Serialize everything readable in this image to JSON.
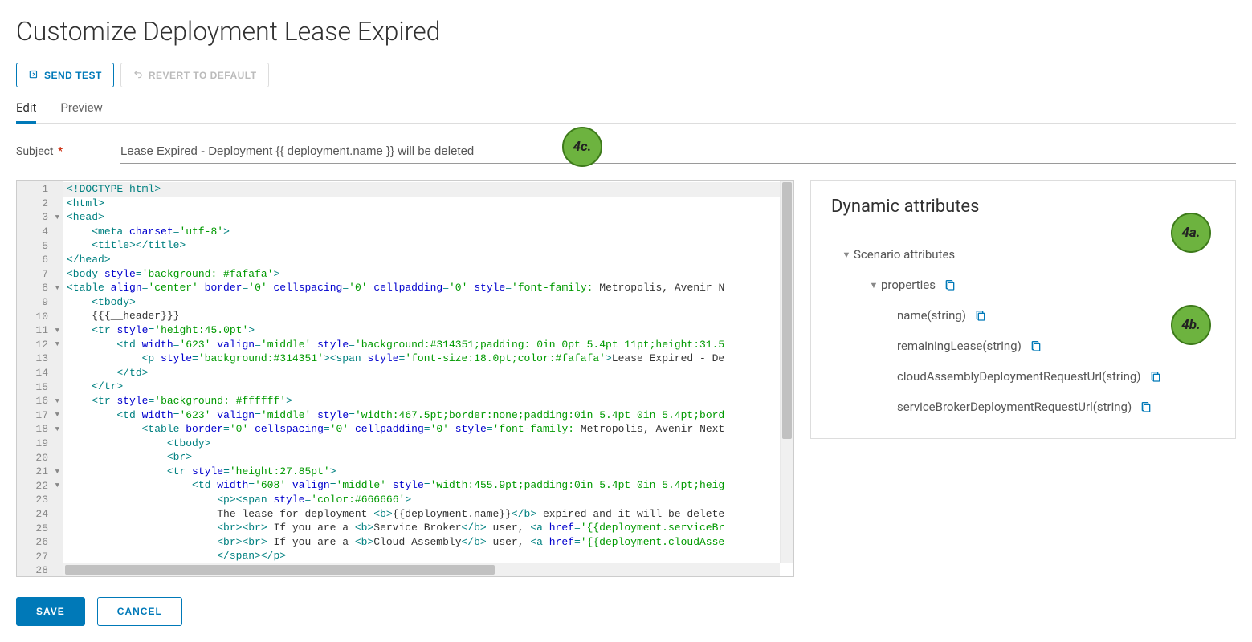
{
  "page": {
    "title": "Customize Deployment Lease Expired"
  },
  "toolbar": {
    "send_test": "SEND TEST",
    "revert": "REVERT TO DEFAULT"
  },
  "tabs": {
    "edit": "Edit",
    "preview": "Preview"
  },
  "subject": {
    "label": "Subject",
    "value": "Lease Expired - Deployment {{ deployment.name }} will be deleted"
  },
  "editor": {
    "lines": [
      {
        "n": 1,
        "active": true,
        "tokens": [
          {
            "c": "t-tag",
            "t": "<!DOCTYPE html>"
          }
        ]
      },
      {
        "n": 2,
        "tokens": [
          {
            "c": "t-tag",
            "t": "<html>"
          }
        ]
      },
      {
        "n": 3,
        "fold": true,
        "tokens": [
          {
            "c": "t-tag",
            "t": "<head>"
          }
        ]
      },
      {
        "n": 4,
        "tokens": [
          {
            "c": "",
            "t": "    "
          },
          {
            "c": "t-tag",
            "t": "<meta "
          },
          {
            "c": "t-attr",
            "t": "charset"
          },
          {
            "c": "t-tag",
            "t": "="
          },
          {
            "c": "t-val",
            "t": "'utf-8'"
          },
          {
            "c": "t-tag",
            "t": ">"
          }
        ]
      },
      {
        "n": 5,
        "tokens": [
          {
            "c": "",
            "t": "    "
          },
          {
            "c": "t-tag",
            "t": "<title></title>"
          }
        ]
      },
      {
        "n": 6,
        "tokens": [
          {
            "c": "t-tag",
            "t": "</head>"
          }
        ]
      },
      {
        "n": 7,
        "tokens": [
          {
            "c": "t-tag",
            "t": "<body "
          },
          {
            "c": "t-attr",
            "t": "style"
          },
          {
            "c": "t-tag",
            "t": "="
          },
          {
            "c": "t-val",
            "t": "'background: #fafafa'"
          },
          {
            "c": "t-tag",
            "t": ">"
          }
        ]
      },
      {
        "n": 8,
        "fold": true,
        "tokens": [
          {
            "c": "t-tag",
            "t": "<table "
          },
          {
            "c": "t-attr",
            "t": "align"
          },
          {
            "c": "t-tag",
            "t": "="
          },
          {
            "c": "t-val",
            "t": "'center' "
          },
          {
            "c": "t-attr",
            "t": "border"
          },
          {
            "c": "t-tag",
            "t": "="
          },
          {
            "c": "t-val",
            "t": "'0' "
          },
          {
            "c": "t-attr",
            "t": "cellspacing"
          },
          {
            "c": "t-tag",
            "t": "="
          },
          {
            "c": "t-val",
            "t": "'0' "
          },
          {
            "c": "t-attr",
            "t": "cellpadding"
          },
          {
            "c": "t-tag",
            "t": "="
          },
          {
            "c": "t-val",
            "t": "'0' "
          },
          {
            "c": "t-attr",
            "t": "style"
          },
          {
            "c": "t-tag",
            "t": "="
          },
          {
            "c": "t-val",
            "t": "'font-family: "
          },
          {
            "c": "t-txt",
            "t": "Metropolis, Avenir N"
          }
        ]
      },
      {
        "n": 9,
        "tokens": [
          {
            "c": "",
            "t": "    "
          },
          {
            "c": "t-tag",
            "t": "<tbody>"
          }
        ]
      },
      {
        "n": 10,
        "tokens": [
          {
            "c": "",
            "t": "    "
          },
          {
            "c": "t-txt",
            "t": "{{{__header}}}"
          }
        ]
      },
      {
        "n": 11,
        "fold": true,
        "tokens": [
          {
            "c": "",
            "t": "    "
          },
          {
            "c": "t-tag",
            "t": "<tr "
          },
          {
            "c": "t-attr",
            "t": "style"
          },
          {
            "c": "t-tag",
            "t": "="
          },
          {
            "c": "t-val",
            "t": "'height:45.0pt'"
          },
          {
            "c": "t-tag",
            "t": ">"
          }
        ]
      },
      {
        "n": 12,
        "fold": true,
        "tokens": [
          {
            "c": "",
            "t": "        "
          },
          {
            "c": "t-tag",
            "t": "<td "
          },
          {
            "c": "t-attr",
            "t": "width"
          },
          {
            "c": "t-tag",
            "t": "="
          },
          {
            "c": "t-val",
            "t": "'623' "
          },
          {
            "c": "t-attr",
            "t": "valign"
          },
          {
            "c": "t-tag",
            "t": "="
          },
          {
            "c": "t-val",
            "t": "'middle' "
          },
          {
            "c": "t-attr",
            "t": "style"
          },
          {
            "c": "t-tag",
            "t": "="
          },
          {
            "c": "t-val",
            "t": "'background:#314351;padding: 0in 0pt 5.4pt 11pt;height:31.5"
          }
        ]
      },
      {
        "n": 13,
        "tokens": [
          {
            "c": "",
            "t": "            "
          },
          {
            "c": "t-tag",
            "t": "<p "
          },
          {
            "c": "t-attr",
            "t": "style"
          },
          {
            "c": "t-tag",
            "t": "="
          },
          {
            "c": "t-val",
            "t": "'background:#314351'"
          },
          {
            "c": "t-tag",
            "t": "><span "
          },
          {
            "c": "t-attr",
            "t": "style"
          },
          {
            "c": "t-tag",
            "t": "="
          },
          {
            "c": "t-val",
            "t": "'font-size:18.0pt;color:#fafafa'"
          },
          {
            "c": "t-tag",
            "t": ">"
          },
          {
            "c": "t-txt",
            "t": "Lease Expired - De"
          }
        ]
      },
      {
        "n": 14,
        "tokens": [
          {
            "c": "",
            "t": "        "
          },
          {
            "c": "t-tag",
            "t": "</td>"
          }
        ]
      },
      {
        "n": 15,
        "tokens": [
          {
            "c": "",
            "t": "    "
          },
          {
            "c": "t-tag",
            "t": "</tr>"
          }
        ]
      },
      {
        "n": 16,
        "fold": true,
        "tokens": [
          {
            "c": "",
            "t": "    "
          },
          {
            "c": "t-tag",
            "t": "<tr "
          },
          {
            "c": "t-attr",
            "t": "style"
          },
          {
            "c": "t-tag",
            "t": "="
          },
          {
            "c": "t-val",
            "t": "'background: #ffffff'"
          },
          {
            "c": "t-tag",
            "t": ">"
          }
        ]
      },
      {
        "n": 17,
        "fold": true,
        "tokens": [
          {
            "c": "",
            "t": "        "
          },
          {
            "c": "t-tag",
            "t": "<td "
          },
          {
            "c": "t-attr",
            "t": "width"
          },
          {
            "c": "t-tag",
            "t": "="
          },
          {
            "c": "t-val",
            "t": "'623' "
          },
          {
            "c": "t-attr",
            "t": "valign"
          },
          {
            "c": "t-tag",
            "t": "="
          },
          {
            "c": "t-val",
            "t": "'middle' "
          },
          {
            "c": "t-attr",
            "t": "style"
          },
          {
            "c": "t-tag",
            "t": "="
          },
          {
            "c": "t-val",
            "t": "'width:467.5pt;border:none;padding:0in 5.4pt 0in 5.4pt;bord"
          }
        ]
      },
      {
        "n": 18,
        "fold": true,
        "tokens": [
          {
            "c": "",
            "t": "            "
          },
          {
            "c": "t-tag",
            "t": "<table "
          },
          {
            "c": "t-attr",
            "t": "border"
          },
          {
            "c": "t-tag",
            "t": "="
          },
          {
            "c": "t-val",
            "t": "'0' "
          },
          {
            "c": "t-attr",
            "t": "cellspacing"
          },
          {
            "c": "t-tag",
            "t": "="
          },
          {
            "c": "t-val",
            "t": "'0' "
          },
          {
            "c": "t-attr",
            "t": "cellpadding"
          },
          {
            "c": "t-tag",
            "t": "="
          },
          {
            "c": "t-val",
            "t": "'0' "
          },
          {
            "c": "t-attr",
            "t": "style"
          },
          {
            "c": "t-tag",
            "t": "="
          },
          {
            "c": "t-val",
            "t": "'font-family: "
          },
          {
            "c": "t-txt",
            "t": "Metropolis, Avenir Next"
          }
        ]
      },
      {
        "n": 19,
        "tokens": [
          {
            "c": "",
            "t": "                "
          },
          {
            "c": "t-tag",
            "t": "<tbody>"
          }
        ]
      },
      {
        "n": 20,
        "tokens": [
          {
            "c": "",
            "t": "                "
          },
          {
            "c": "t-tag",
            "t": "<br>"
          }
        ]
      },
      {
        "n": 21,
        "fold": true,
        "tokens": [
          {
            "c": "",
            "t": "                "
          },
          {
            "c": "t-tag",
            "t": "<tr "
          },
          {
            "c": "t-attr",
            "t": "style"
          },
          {
            "c": "t-tag",
            "t": "="
          },
          {
            "c": "t-val",
            "t": "'height:27.85pt'"
          },
          {
            "c": "t-tag",
            "t": ">"
          }
        ]
      },
      {
        "n": 22,
        "fold": true,
        "tokens": [
          {
            "c": "",
            "t": "                    "
          },
          {
            "c": "t-tag",
            "t": "<td "
          },
          {
            "c": "t-attr",
            "t": "width"
          },
          {
            "c": "t-tag",
            "t": "="
          },
          {
            "c": "t-val",
            "t": "'608' "
          },
          {
            "c": "t-attr",
            "t": "valign"
          },
          {
            "c": "t-tag",
            "t": "="
          },
          {
            "c": "t-val",
            "t": "'middle' "
          },
          {
            "c": "t-attr",
            "t": "style"
          },
          {
            "c": "t-tag",
            "t": "="
          },
          {
            "c": "t-val",
            "t": "'width:455.9pt;padding:0in 5.4pt 0in 5.4pt;heig"
          }
        ]
      },
      {
        "n": 23,
        "tokens": [
          {
            "c": "",
            "t": "                        "
          },
          {
            "c": "t-tag",
            "t": "<p><span "
          },
          {
            "c": "t-attr",
            "t": "style"
          },
          {
            "c": "t-tag",
            "t": "="
          },
          {
            "c": "t-val",
            "t": "'color:#666666'"
          },
          {
            "c": "t-tag",
            "t": ">"
          }
        ]
      },
      {
        "n": 24,
        "tokens": [
          {
            "c": "",
            "t": "                        "
          },
          {
            "c": "t-txt",
            "t": "The lease for deployment "
          },
          {
            "c": "t-tag",
            "t": "<b>"
          },
          {
            "c": "t-txt",
            "t": "{{deployment.name}}"
          },
          {
            "c": "t-tag",
            "t": "</b>"
          },
          {
            "c": "t-txt",
            "t": " expired and it will be delete"
          }
        ]
      },
      {
        "n": 25,
        "tokens": [
          {
            "c": "",
            "t": "                        "
          },
          {
            "c": "t-tag",
            "t": "<br><br>"
          },
          {
            "c": "t-txt",
            "t": " If you are a "
          },
          {
            "c": "t-tag",
            "t": "<b>"
          },
          {
            "c": "t-txt",
            "t": "Service Broker"
          },
          {
            "c": "t-tag",
            "t": "</b>"
          },
          {
            "c": "t-txt",
            "t": " user, "
          },
          {
            "c": "t-tag",
            "t": "<a "
          },
          {
            "c": "t-attr",
            "t": "href"
          },
          {
            "c": "t-tag",
            "t": "="
          },
          {
            "c": "t-val",
            "t": "'{{deployment.serviceBr"
          }
        ]
      },
      {
        "n": 26,
        "tokens": [
          {
            "c": "",
            "t": "                        "
          },
          {
            "c": "t-tag",
            "t": "<br><br>"
          },
          {
            "c": "t-txt",
            "t": " If you are a "
          },
          {
            "c": "t-tag",
            "t": "<b>"
          },
          {
            "c": "t-txt",
            "t": "Cloud Assembly"
          },
          {
            "c": "t-tag",
            "t": "</b>"
          },
          {
            "c": "t-txt",
            "t": " user, "
          },
          {
            "c": "t-tag",
            "t": "<a "
          },
          {
            "c": "t-attr",
            "t": "href"
          },
          {
            "c": "t-tag",
            "t": "="
          },
          {
            "c": "t-val",
            "t": "'{{deployment.cloudAsse"
          }
        ]
      },
      {
        "n": 27,
        "tokens": [
          {
            "c": "",
            "t": "                        "
          },
          {
            "c": "t-tag",
            "t": "</span></p>"
          }
        ]
      },
      {
        "n": 28,
        "tokens": []
      }
    ]
  },
  "side": {
    "title": "Dynamic attributes",
    "scenario": "Scenario attributes",
    "properties": "properties",
    "attrs": [
      "name(string)",
      "remainingLease(string)",
      "cloudAssemblyDeploymentRequestUrl(string)",
      "serviceBrokerDeploymentRequestUrl(string)"
    ]
  },
  "actions": {
    "save": "SAVE",
    "cancel": "CANCEL"
  },
  "badges": {
    "b4a": "4a.",
    "b4b": "4b.",
    "b4c": "4c."
  }
}
